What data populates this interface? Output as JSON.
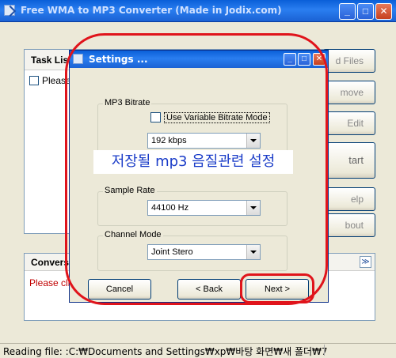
{
  "main_window": {
    "title": "Free WMA to MP3 Converter   (Made in Jodix.com)",
    "task_list_header": "Task Lis",
    "task_item": "Please",
    "side_buttons": [
      "d Files",
      "move",
      "Edit",
      "tart",
      "elp",
      "bout"
    ],
    "conversion_header": "Convers",
    "conversion_text": "Please cli",
    "collapse_symbol": "≫",
    "status_text": "Reading file: :C:₩Documents and Settings₩xp₩바탕 화면₩새 폴더₩7"
  },
  "dialog": {
    "title": "Settings ...",
    "mp3_bitrate": {
      "group_label": "MP3 Bitrate",
      "vbr_checkbox_label": "Use Variable Bitrate Mode",
      "vbr_checked": false,
      "bitrate_value": "192 kbps"
    },
    "overlay_note": "저장될 mp3 음질관련 설정",
    "sample_rate": {
      "group_label": "Sample Rate",
      "value": "44100 Hz"
    },
    "channel_mode": {
      "group_label": "Channel Mode",
      "value": "Joint Stero"
    },
    "buttons": {
      "cancel": "Cancel",
      "back": "< Back",
      "next": "Next >"
    }
  },
  "colors": {
    "titlebar": "#0a5fd8",
    "highlight_red": "#e0141b",
    "note_text": "#1a3cc8",
    "status_red": "#c00000"
  }
}
